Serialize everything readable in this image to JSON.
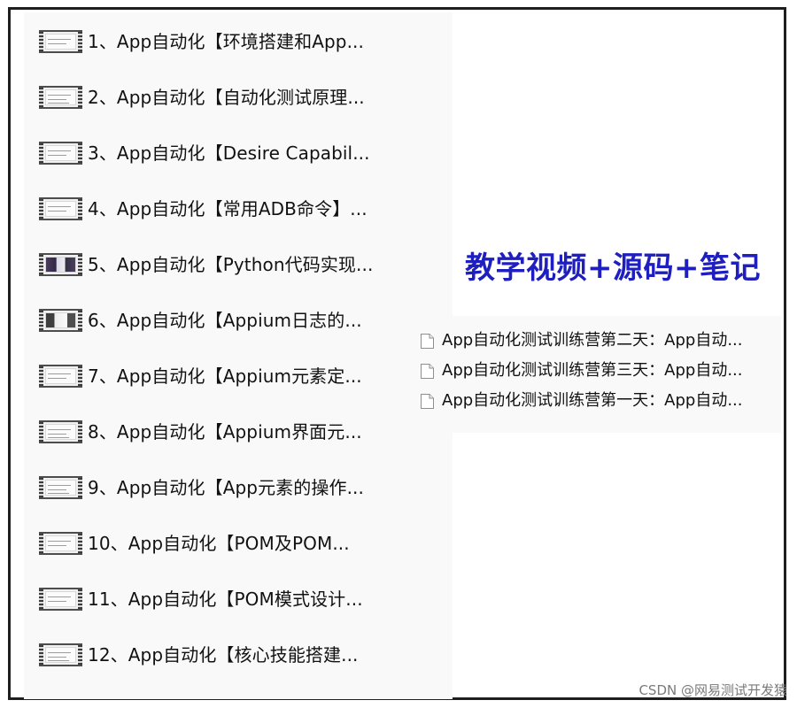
{
  "headline": "教学视频+源码+笔记",
  "videos": [
    {
      "label": "1、App自动化【环境搭建和App...",
      "thumbnail": "video-thumbnail"
    },
    {
      "label": "2、App自动化【自动化测试原理...",
      "thumbnail": "video-thumbnail"
    },
    {
      "label": "3、App自动化【Desire Capabil...",
      "thumbnail": "video-thumbnail"
    },
    {
      "label": "4、App自动化【常用ADB命令】...",
      "thumbnail": "video-thumbnail"
    },
    {
      "label": "5、App自动化【Python代码实现...",
      "thumbnail": "video-thumbnail-dark"
    },
    {
      "label": "6、App自动化【Appium日志的...",
      "thumbnail": "video-thumbnail-dark"
    },
    {
      "label": "7、App自动化【Appium元素定...",
      "thumbnail": "video-thumbnail"
    },
    {
      "label": "8、App自动化【Appium界面元...",
      "thumbnail": "video-thumbnail"
    },
    {
      "label": "9、App自动化【App元素的操作...",
      "thumbnail": "video-thumbnail"
    },
    {
      "label": "10、App自动化【POM及POM...",
      "thumbnail": "video-thumbnail"
    },
    {
      "label": "11、App自动化【POM模式设计...",
      "thumbnail": "video-thumbnail"
    },
    {
      "label": "12、App自动化【核心技能搭建...",
      "thumbnail": "video-thumbnail"
    }
  ],
  "documents": [
    {
      "label": "App自动化测试训练营第二天：App自动...",
      "icon": "document-icon"
    },
    {
      "label": "App自动化测试训练营第三天：App自动...",
      "icon": "document-icon"
    },
    {
      "label": "App自动化测试训练营第一天：App自动...",
      "icon": "document-icon"
    }
  ],
  "watermark": "CSDN @网易测试开发猿",
  "colors": {
    "headline": "#1f1fc0",
    "frame_border": "#1e1e1e",
    "panel_background": "#f9f9f9"
  }
}
